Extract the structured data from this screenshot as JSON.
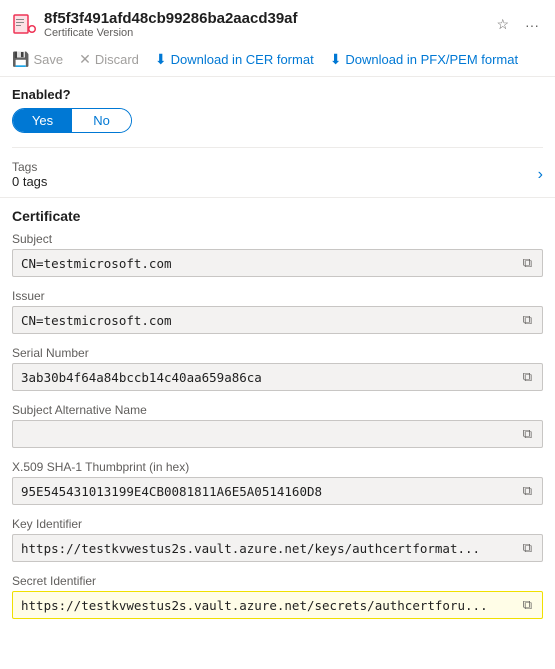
{
  "header": {
    "title": "8f5f3f491afd48cb99286ba2aacd39af",
    "subtitle": "Certificate Version",
    "pin_label": "Pin",
    "more_label": "More"
  },
  "toolbar": {
    "save_label": "Save",
    "discard_label": "Discard",
    "download_cer_label": "Download in CER format",
    "download_pfx_label": "Download in PFX/PEM format"
  },
  "enabled": {
    "label": "Enabled?",
    "yes_label": "Yes",
    "no_label": "No"
  },
  "tags": {
    "label": "Tags",
    "count": "0 tags"
  },
  "certificate": {
    "section_label": "Certificate",
    "subject": {
      "label": "Subject",
      "value": "CN=testmicrosoft.com"
    },
    "issuer": {
      "label": "Issuer",
      "value": "CN=testmicrosoft.com"
    },
    "serial_number": {
      "label": "Serial Number",
      "value": "3ab30b4f64a84bccb14c40aa659a86ca"
    },
    "subject_alt_name": {
      "label": "Subject Alternative Name",
      "value": ""
    },
    "thumbprint": {
      "label": "X.509 SHA-1 Thumbprint (in hex)",
      "value": "95E545431013199E4CB0081811A6E5A0514160D8"
    },
    "key_identifier": {
      "label": "Key Identifier",
      "value": "https://testkvwestus2s.vault.azure.net/keys/authcertformat..."
    },
    "secret_identifier": {
      "label": "Secret Identifier",
      "value": "https://testkvwestus2s.vault.azure.net/secrets/authcertforu..."
    }
  },
  "icons": {
    "certificate": "🔴",
    "save": "💾",
    "discard": "✕",
    "download": "⬇",
    "copy": "⧉",
    "chevron": "›",
    "pin": "☆",
    "more": "···"
  }
}
